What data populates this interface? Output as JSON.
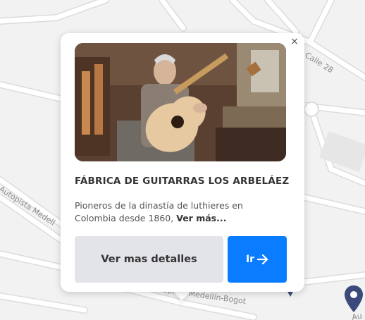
{
  "map": {
    "road_labels": [
      "Calle 28",
      "Autopista Medell",
      "Autopista Medellín-Bogot",
      "Au"
    ],
    "colors": {
      "background": "#f2f2f2",
      "road": "#ffffff",
      "road_edge": "#dcdcdc",
      "pin": "#3b4a7a"
    }
  },
  "popup": {
    "close_label": "×",
    "photo_alt": "Luthier holding a guitar in a workshop",
    "title": "FÁBRICA DE GUITARRAS LOS ARBELÁEZ",
    "description": "Pioneros de la dinastía de luthieres en Colombia desde 1860, ",
    "more_link": "Ver más...",
    "details_button": "Ver mas detalles",
    "go_button": "Ir",
    "go_icon": "arrow-right-icon",
    "colors": {
      "primary": "#0a7cff",
      "secondary": "#e3e4ea"
    }
  }
}
